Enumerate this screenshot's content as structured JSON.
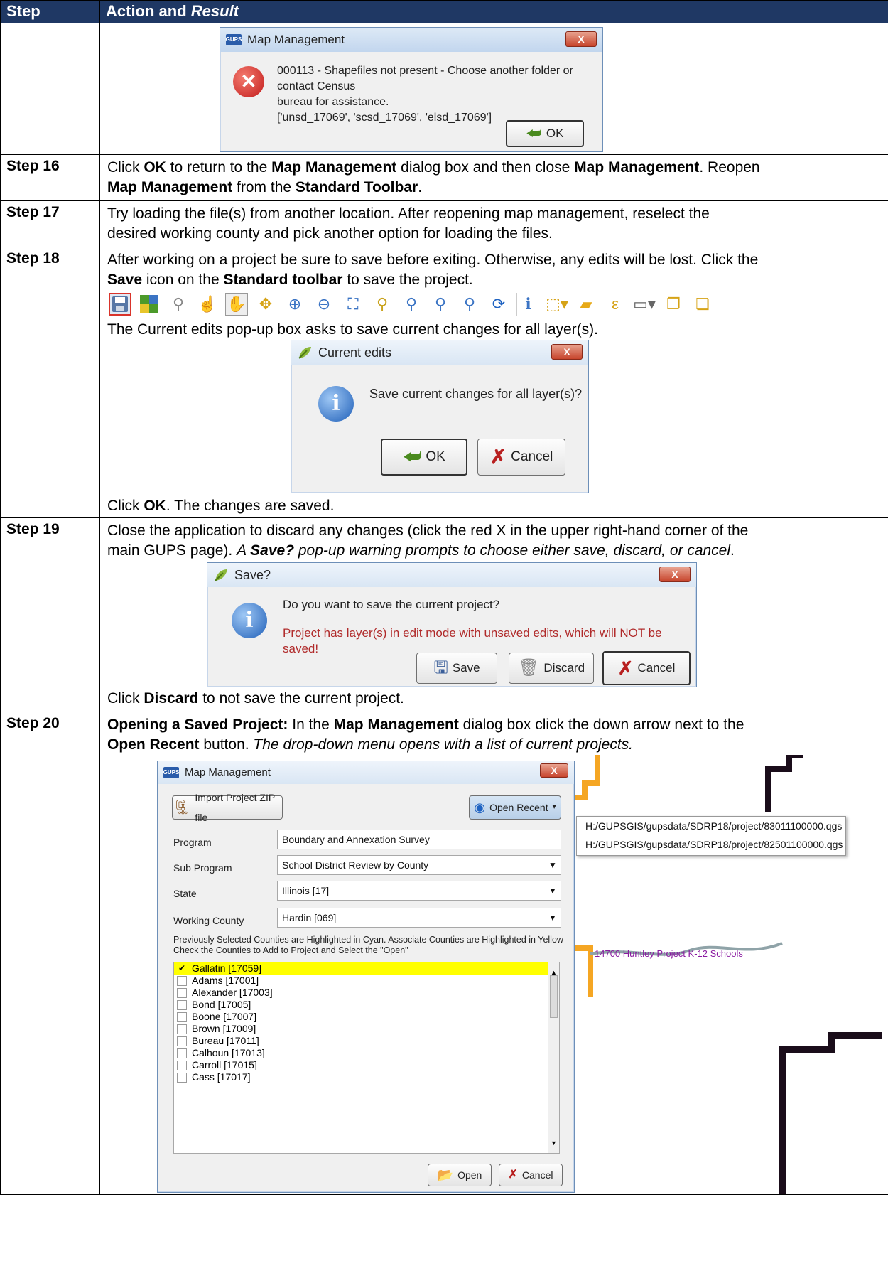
{
  "table": {
    "header_step": "Step",
    "header_action": "Action and ",
    "header_result": "Result"
  },
  "step15_dialog": {
    "title": "Map Management",
    "message_line1": "000113 - Shapefiles not present - Choose another folder or contact Census",
    "message_line2": "bureau for assistance.",
    "message_line3": "['unsd_17069', 'scsd_17069', 'elsd_17069']",
    "ok_label": "OK",
    "close_label": "X",
    "app_icon": "GUPS"
  },
  "step16": {
    "label": "Step 16",
    "t1": "Click ",
    "b1": "OK",
    "t2": " to return to the ",
    "b2": "Map Management",
    "t3": " dialog box and then close ",
    "b3": "Map Management",
    "t4": ". Reopen",
    "b4": "Map Management",
    "t5": " from the ",
    "b5": "Standard Toolbar",
    "t6": "."
  },
  "step17": {
    "label": "Step 17",
    "line1": "Try loading the file(s) from another location. After reopening map management, reselect the",
    "line2": "desired working county and pick another option for loading the files."
  },
  "step18": {
    "label": "Step 18",
    "line1": "After working on a project be sure to save before exiting. Otherwise, any edits will be lost. Click the",
    "b1": "Save",
    "t1": " icon on the ",
    "b2": "Standard toolbar",
    "t2": " to save the project.",
    "after_toolbar": "The Current edits pop-up box asks to save current changes for all layer(s).",
    "dialog_title": "Current edits",
    "dialog_message": "Save current changes for all layer(s)?",
    "ok_label": "OK",
    "cancel_label": "Cancel",
    "close_label": "X",
    "final_t1": "Click ",
    "final_b1": "OK",
    "final_t2": ". The changes are saved."
  },
  "toolbar_icons": [
    "save-icon",
    "new-project-icon",
    "open-icon",
    "pan-icon",
    "hand-icon",
    "zoom-full-icon",
    "zoom-in-icon",
    "zoom-out-icon",
    "zoom-layer-icon",
    "zoom-selection-icon",
    "zoom-actual-icon",
    "zoom-last-icon",
    "zoom-next-icon",
    "refresh-icon",
    "identify-icon",
    "select-icon",
    "deselect-icon",
    "expression-select-icon",
    "measure-icon",
    "add-feature-icon",
    "add-note-icon"
  ],
  "step19": {
    "label": "Step 19",
    "line1": "Close the application to discard any changes (click the red X in the upper right-hand corner of the",
    "t1": "main GUPS page). ",
    "i1": "A ",
    "bi1": "Save?",
    "i2": " pop-up warning prompts to choose either save, discard, or cancel",
    "t2": ".",
    "dialog_title": "Save?",
    "question": "Do you want to save the current project?",
    "warning": "Project has layer(s) in edit mode with unsaved edits, which will NOT be saved!",
    "save_label": "Save",
    "discard_label": "Discard",
    "cancel_label": "Cancel",
    "close_label": "X",
    "final_t1": "Click ",
    "final_b1": "Discard",
    "final_t2": " to not save the current project."
  },
  "step20": {
    "label": "Step 20",
    "b1": "Opening a Saved Project:",
    "t1": " In the ",
    "b2": "Map Management",
    "t2": " dialog box click the down arrow next to the",
    "b3": "Open Recent",
    "t3": " button. ",
    "i1": "The drop-down menu opens with a list of current projects.",
    "dialog_title": "Map Management",
    "close_label": "X",
    "import_label": "Import Project ZIP file",
    "open_recent_label": "Open Recent",
    "recent_items": [
      "H:/GUPSGIS/gupsdata/SDRP18/project/83011100000.qgs",
      "H:/GUPSGIS/gupsdata/SDRP18/project/82501100000.qgs"
    ],
    "program_label": "Program",
    "program_value": "Boundary and Annexation Survey",
    "subprogram_label": "Sub Program",
    "subprogram_value": "School District Review by County",
    "state_label": "State",
    "state_value": "Illinois [17]",
    "county_label": "Working County",
    "county_value": "Hardin [069]",
    "instructions_line1": "Previously Selected Counties are Highlighted in Cyan. Associate Counties are Highlighted in Yellow -",
    "instructions_line2": "Check the Counties to Add to Project and Select the \"Open\"",
    "counties": [
      {
        "name": "Gallatin [17059]",
        "checked": true,
        "highlight": "yellow"
      },
      {
        "name": "Adams [17001]",
        "checked": false
      },
      {
        "name": "Alexander [17003]",
        "checked": false
      },
      {
        "name": "Bond [17005]",
        "checked": false
      },
      {
        "name": "Boone [17007]",
        "checked": false
      },
      {
        "name": "Brown [17009]",
        "checked": false
      },
      {
        "name": "Bureau [17011]",
        "checked": false
      },
      {
        "name": "Calhoun [17013]",
        "checked": false
      },
      {
        "name": "Carroll [17015]",
        "checked": false
      },
      {
        "name": "Cass [17017]",
        "checked": false
      }
    ],
    "open_label": "Open",
    "cancel_label": "Cancel",
    "map_label": "14700 Huntley Project K-12 Schools"
  },
  "colors": {
    "header_bg": "#1f3864",
    "yellow_highlight": "#ffff00",
    "warning_red": "#c0392b",
    "map_boundary_orange": "#f5a623",
    "map_boundary_black": "#1a0d1a"
  }
}
